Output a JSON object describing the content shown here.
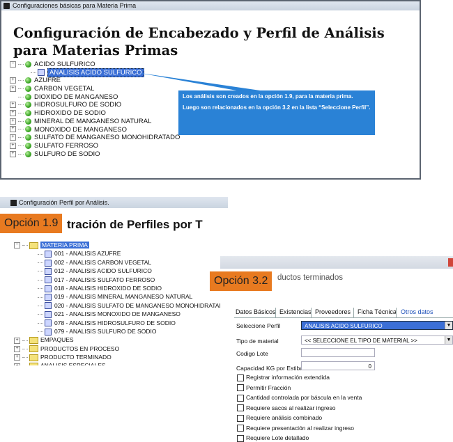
{
  "panel1": {
    "window_title": "Configuraciones básicas para Materia Prima",
    "heading": "Configuración de Encabezado y Perfil de Análisis para Materias Primas",
    "tree": [
      {
        "label": "ACIDO SULFURICO",
        "toggle": "⊟",
        "expanded": true
      },
      {
        "label": "ANALISIS ACIDO SULFURICO",
        "child": true,
        "selected": true
      },
      {
        "label": "AZUFRE",
        "toggle": "⊞"
      },
      {
        "label": "CARBON VEGETAL",
        "toggle": "⊞"
      },
      {
        "label": "DIOXIDO DE MANGANESO",
        "toggle": ""
      },
      {
        "label": "HIDROSULFURO DE SODIO",
        "toggle": "⊞"
      },
      {
        "label": "HIDROXIDO DE SODIO",
        "toggle": "⊞"
      },
      {
        "label": "MINERAL DE MANGANESO NATURAL",
        "toggle": "⊞"
      },
      {
        "label": "MONOXIDO DE MANGANESO",
        "toggle": "⊞"
      },
      {
        "label": "SULFATO DE MANGANESO MONOHIDRATADO",
        "toggle": "⊞"
      },
      {
        "label": "SULFATO FERROSO",
        "toggle": "⊞"
      },
      {
        "label": "SULFURO DE SODIO",
        "toggle": "⊞"
      }
    ],
    "callout_line1": "Los análisis son creados en la opción 1.9, para la materia prima.",
    "callout_line2": "Luego son relacionados en la opción 3.2   en la lista “Seleccione Perfil”.",
    "callout_color": "#2a82d6"
  },
  "panel2": {
    "window_title": "Configuración Perfil por Análisis.",
    "heading_visible": "tración de Perfiles por  T",
    "tag": "Opción 1.9",
    "root": "MATERIA PRIMA",
    "items": [
      "001 - ANALISIS AZUFRE",
      "002 - ANALISIS CARBON VEGETAL",
      "012 - ANALISIS ACIDO SULFURICO",
      "017 - ANALISIS SULFATO FERROSO",
      "018 - ANALISIS HIDROXIDO DE SODIO",
      "019 - ANALISIS MINERAL MANGANESO NATURAL",
      "020 - ANALISIS SULFATO DE MANGANESO MONOHIDRATADO",
      "021 - ANALISIS MONOXIDO DE MANGANESO",
      "078 - ANALISIS HIDROSULFURO DE SODIO",
      "079 - ANALISIS SULFURO DE SODIO"
    ],
    "folders": [
      "EMPAQUES",
      "PRODUCTOS EN PROCESO",
      "PRODUCTO TERMINADO",
      "ANALISIS ESPECIALES"
    ],
    "tag_color": "#e87a20"
  },
  "panel3": {
    "tag": "Opción 3.2",
    "title_visible": "ductos terminados",
    "tabs": [
      "Datos Básicos",
      "Existencias",
      "Proveedores",
      "Ficha Técnica",
      "Otros datos"
    ],
    "fields": {
      "perfil_label": "Seleccione Perfil",
      "perfil_value": "ANALISIS ACIDO SULFURICO",
      "tipo_label": "Tipo de material",
      "tipo_value": "<< SELECCIONE EL TIPO DE MATERIAL >>",
      "lote_label": "Codigo Lote",
      "lote_value": "",
      "capacidad_label": "Capacidad KG por Estiba",
      "capacidad_value": "0"
    },
    "checkboxes": [
      "Registrar información extendida",
      "Permitir Fracción",
      "Cantidad controlada por báscula en la venta",
      "Requiere sacos al realizar ingreso",
      "Requiere análisis combinado",
      "Requiere presentación al realizar ingreso",
      "Requiere Lote detallado"
    ]
  }
}
